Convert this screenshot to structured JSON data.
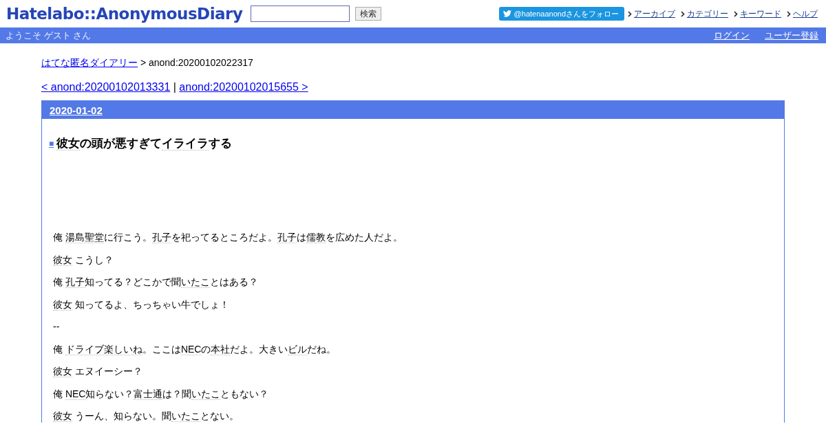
{
  "header": {
    "logo": "Hatelabo::AnonymousDiary",
    "search_button": "検索",
    "follow_button": "@hatenaanondさんをフォロー",
    "nav_links": [
      "アーカイブ",
      "カテゴリー",
      "キーワード",
      "ヘルプ"
    ]
  },
  "user_bar": {
    "welcome": "ようこそ ゲスト さん",
    "links": [
      "ログイン",
      "ユーザー登録"
    ]
  },
  "breadcrumb": {
    "link": "はてな匿名ダイアリー",
    "current": " > anond:20200102022317"
  },
  "pager": {
    "prev": "< anond:20200102013331",
    "separator": " | ",
    "next": "anond:20200102015655 >"
  },
  "day": {
    "date": "2020-01-02",
    "section_mark": "■",
    "title": [
      {
        "text": "彼女",
        "keyword": true
      },
      {
        "text": "の頭が悪すぎて",
        "keyword": false
      },
      {
        "text": "イライラ",
        "keyword": true
      },
      {
        "text": "する",
        "keyword": false
      }
    ],
    "paragraphs": [
      [
        {
          "text": "俺 ",
          "keyword": false
        },
        {
          "text": "湯島聖堂",
          "keyword": true
        },
        {
          "text": "に行こう。",
          "keyword": false
        },
        {
          "text": "孔子",
          "keyword": true
        },
        {
          "text": "を祀ってるところだよ。",
          "keyword": false
        },
        {
          "text": "孔子",
          "keyword": true
        },
        {
          "text": "は",
          "keyword": false
        },
        {
          "text": "儒教",
          "keyword": true
        },
        {
          "text": "を広めた人だよ。",
          "keyword": false
        }
      ],
      [
        {
          "text": "彼女",
          "keyword": true
        },
        {
          "text": " こうし？",
          "keyword": false
        }
      ],
      [
        {
          "text": "俺 ",
          "keyword": false
        },
        {
          "text": "孔子",
          "keyword": true
        },
        {
          "text": "知ってる？どこかで聞",
          "keyword": false
        },
        {
          "text": "いたこ",
          "keyword": true
        },
        {
          "text": "とはある？",
          "keyword": false
        }
      ],
      [
        {
          "text": "彼女",
          "keyword": true
        },
        {
          "text": " 知ってるよ、ちっちゃい牛でしょ！",
          "keyword": false
        }
      ],
      [
        {
          "text": "--",
          "keyword": false
        }
      ],
      [
        {
          "text": "俺 ",
          "keyword": false
        },
        {
          "text": "ドライブ楽しいね",
          "keyword": true
        },
        {
          "text": "。ここは",
          "keyword": false
        },
        {
          "text": "NEC",
          "keyword": true
        },
        {
          "text": "の",
          "keyword": false
        },
        {
          "text": "本社",
          "keyword": true
        },
        {
          "text": "だよ。大きい",
          "keyword": false
        },
        {
          "text": "ビル",
          "keyword": true
        },
        {
          "text": "だね。",
          "keyword": false
        }
      ],
      [
        {
          "text": "彼女",
          "keyword": true
        },
        {
          "text": " エヌイーシー？",
          "keyword": false
        }
      ],
      [
        {
          "text": "俺 ",
          "keyword": false
        },
        {
          "text": "NEC",
          "keyword": true
        },
        {
          "text": "知らない？",
          "keyword": false
        },
        {
          "text": "富士通",
          "keyword": true
        },
        {
          "text": "は？聞",
          "keyword": false
        },
        {
          "text": "いたこ",
          "keyword": true
        },
        {
          "text": "ともない？",
          "keyword": false
        }
      ],
      [
        {
          "text": "彼女",
          "keyword": true
        },
        {
          "text": " うーん、知らない。聞",
          "keyword": false
        },
        {
          "text": "いたこ",
          "keyword": true
        },
        {
          "text": "とない。",
          "keyword": false
        }
      ]
    ]
  }
}
